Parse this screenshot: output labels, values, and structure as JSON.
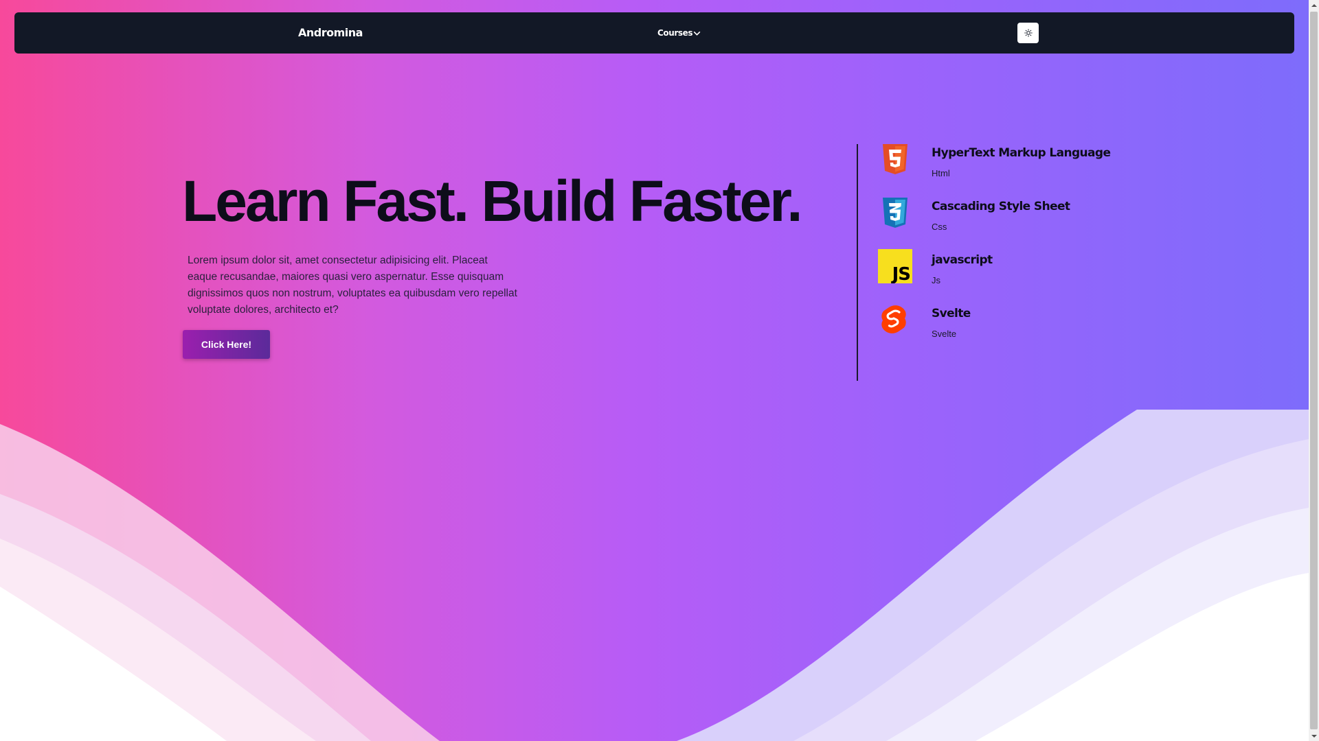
{
  "navbar": {
    "brand": "Andromina",
    "courses_label": "Courses",
    "theme_icon": "sun-icon"
  },
  "hero": {
    "title": "Learn Fast. Build Faster.",
    "text": "Lorem ipsum dolor sit, amet consectetur adipisicing elit. Placeat eaque recusandae, maiores quasi vero aspernatur. Esse quisquam dignissimos quos non nostrum, voluptates ea quibusdam vero repellat voluptate dolores, architecto et?",
    "cta_label": "Click Here!"
  },
  "technologies": [
    {
      "name": "HyperText Markup Language",
      "short": "Html",
      "icon": "html5-icon"
    },
    {
      "name": "Cascading Style Sheet",
      "short": "Css",
      "icon": "css3-icon"
    },
    {
      "name": "javascript",
      "short": "Js",
      "icon": "javascript-icon"
    },
    {
      "name": "Svelte",
      "short": "Svelte",
      "icon": "svelte-icon"
    }
  ],
  "colors": {
    "gradient_left": "#f7499b",
    "gradient_mid": "#b75cf6",
    "gradient_right": "#7d6cfb",
    "navbar": "#121826",
    "html5": "#e44d26",
    "css3": "#1572b6",
    "javascript": "#f7df1e",
    "svelte": "#ff3e00"
  }
}
